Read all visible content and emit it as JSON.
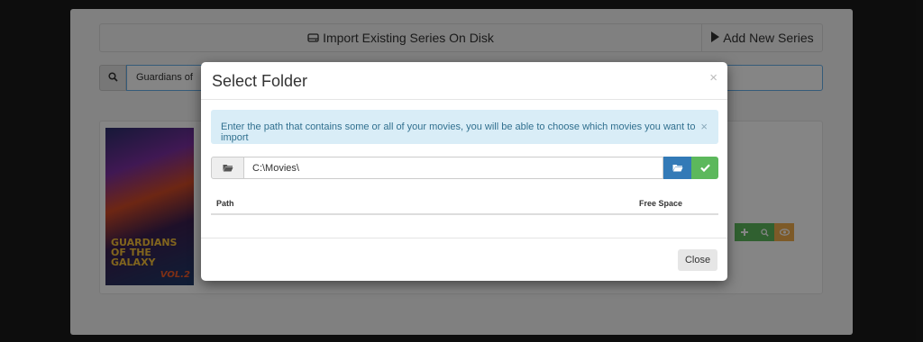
{
  "background": {
    "import_label": "Import Existing Series On Disk",
    "add_new_label": "Add New Series",
    "search_value": "Guardians of",
    "poster_title": "GUARDIANS OF THE GALAXY",
    "poster_vol": "VOL.2"
  },
  "modal": {
    "title": "Select Folder",
    "close_x": "×",
    "alert_text": "Enter the path that contains some or all of your movies, you will be able to choose which movies you want to import",
    "alert_close": "×",
    "path_value": "C:\\Movies\\",
    "table_headers": {
      "path": "Path",
      "free_space": "Free Space"
    },
    "close_button": "Close"
  },
  "colors": {
    "primary": "#337ab7",
    "success": "#5cb85c",
    "warning": "#f0ad4e",
    "info_bg": "#d9edf7",
    "info_text": "#31708f"
  }
}
